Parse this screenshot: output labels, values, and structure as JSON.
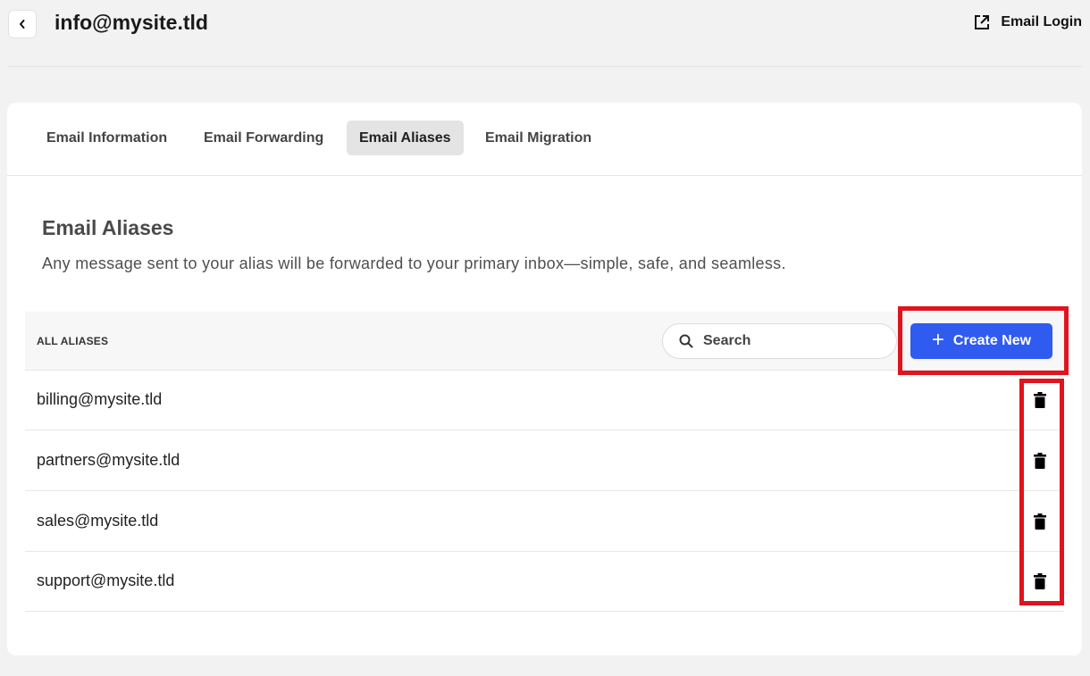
{
  "header": {
    "title": "info@mysite.tld",
    "email_login_label": "Email Login"
  },
  "tabs": [
    {
      "label": "Email Information",
      "active": false
    },
    {
      "label": "Email Forwarding",
      "active": false
    },
    {
      "label": "Email Aliases",
      "active": true
    },
    {
      "label": "Email Migration",
      "active": false
    }
  ],
  "section": {
    "title": "Email Aliases",
    "description": "Any message sent to your alias will be forwarded to your primary inbox—simple, safe, and seamless."
  },
  "table": {
    "header_label": "ALL ALIASES",
    "search_placeholder": "Search",
    "create_label": "Create New",
    "rows": [
      {
        "alias": "billing@mysite.tld"
      },
      {
        "alias": "partners@mysite.tld"
      },
      {
        "alias": "sales@mysite.tld"
      },
      {
        "alias": "support@mysite.tld"
      }
    ]
  },
  "colors": {
    "accent": "#2f5bf0",
    "highlight": "#e0141e",
    "page_bg": "#f2f2f2"
  },
  "icons": {
    "back": "chevron-left-icon",
    "email_login": "external-link-icon",
    "search": "search-icon",
    "create": "plus-icon",
    "delete": "trash-icon"
  }
}
